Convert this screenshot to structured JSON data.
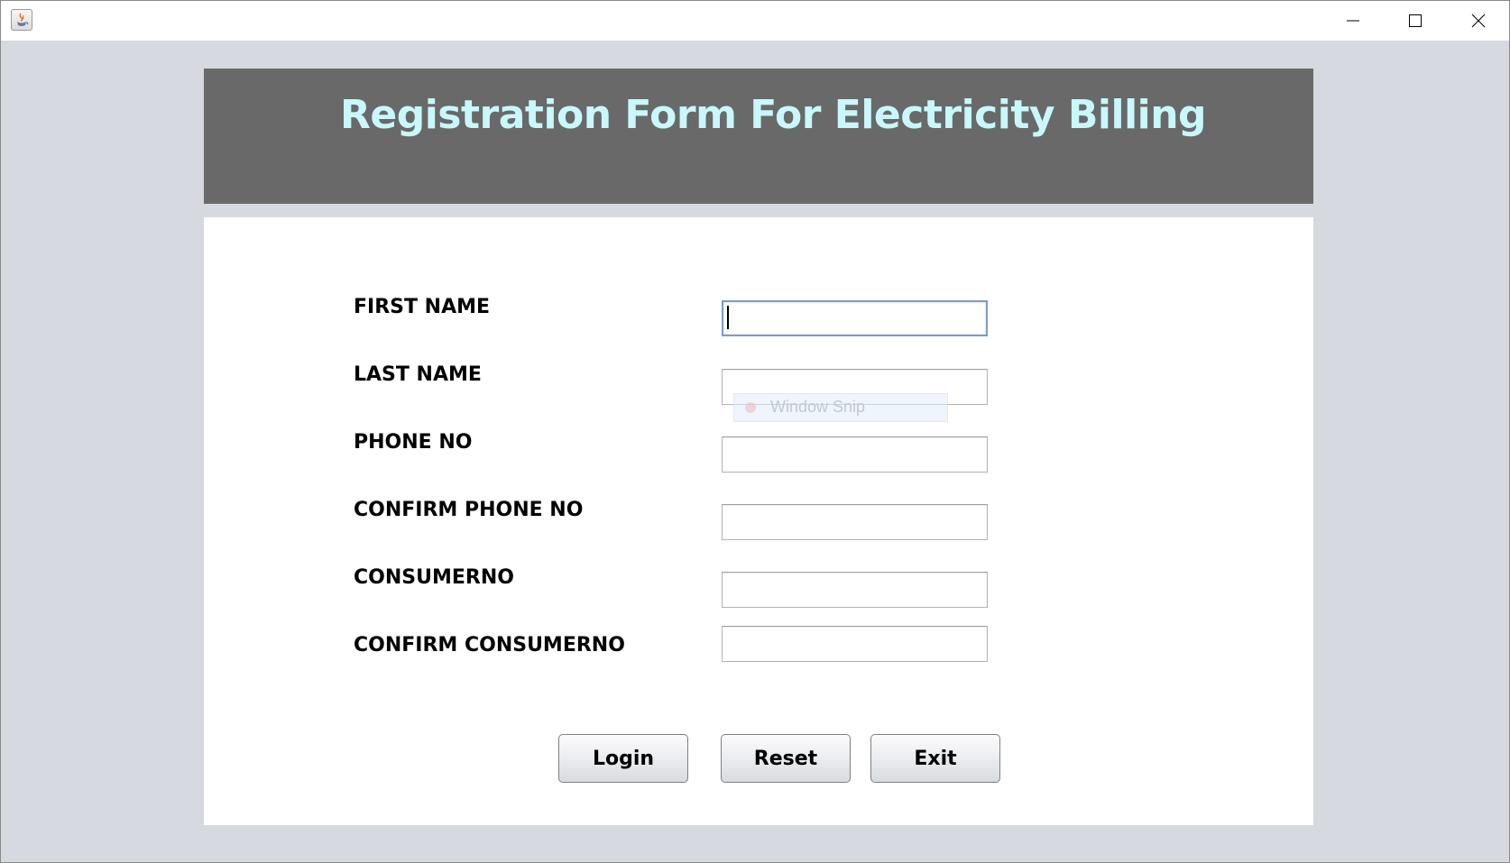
{
  "window": {
    "controls": {
      "minimize_icon": "minimize-icon",
      "maximize_icon": "maximize-icon",
      "close_icon": "close-icon"
    }
  },
  "header": {
    "title": "Registration Form For Electricity Billing",
    "background": "#696969",
    "title_color": "#c8f8fb"
  },
  "form": {
    "fields": [
      {
        "label": "FIRST NAME",
        "value": "",
        "focused": true
      },
      {
        "label": "LAST NAME",
        "value": ""
      },
      {
        "label": "PHONE NO",
        "value": ""
      },
      {
        "label": "CONFIRM PHONE NO",
        "value": ""
      },
      {
        "label": "CONSUMERNO",
        "value": ""
      },
      {
        "label": "CONFIRM CONSUMERNO",
        "value": ""
      }
    ],
    "snip_hint": "Window Snip"
  },
  "buttons": {
    "login": "Login",
    "reset": "Reset",
    "exit": "Exit"
  }
}
